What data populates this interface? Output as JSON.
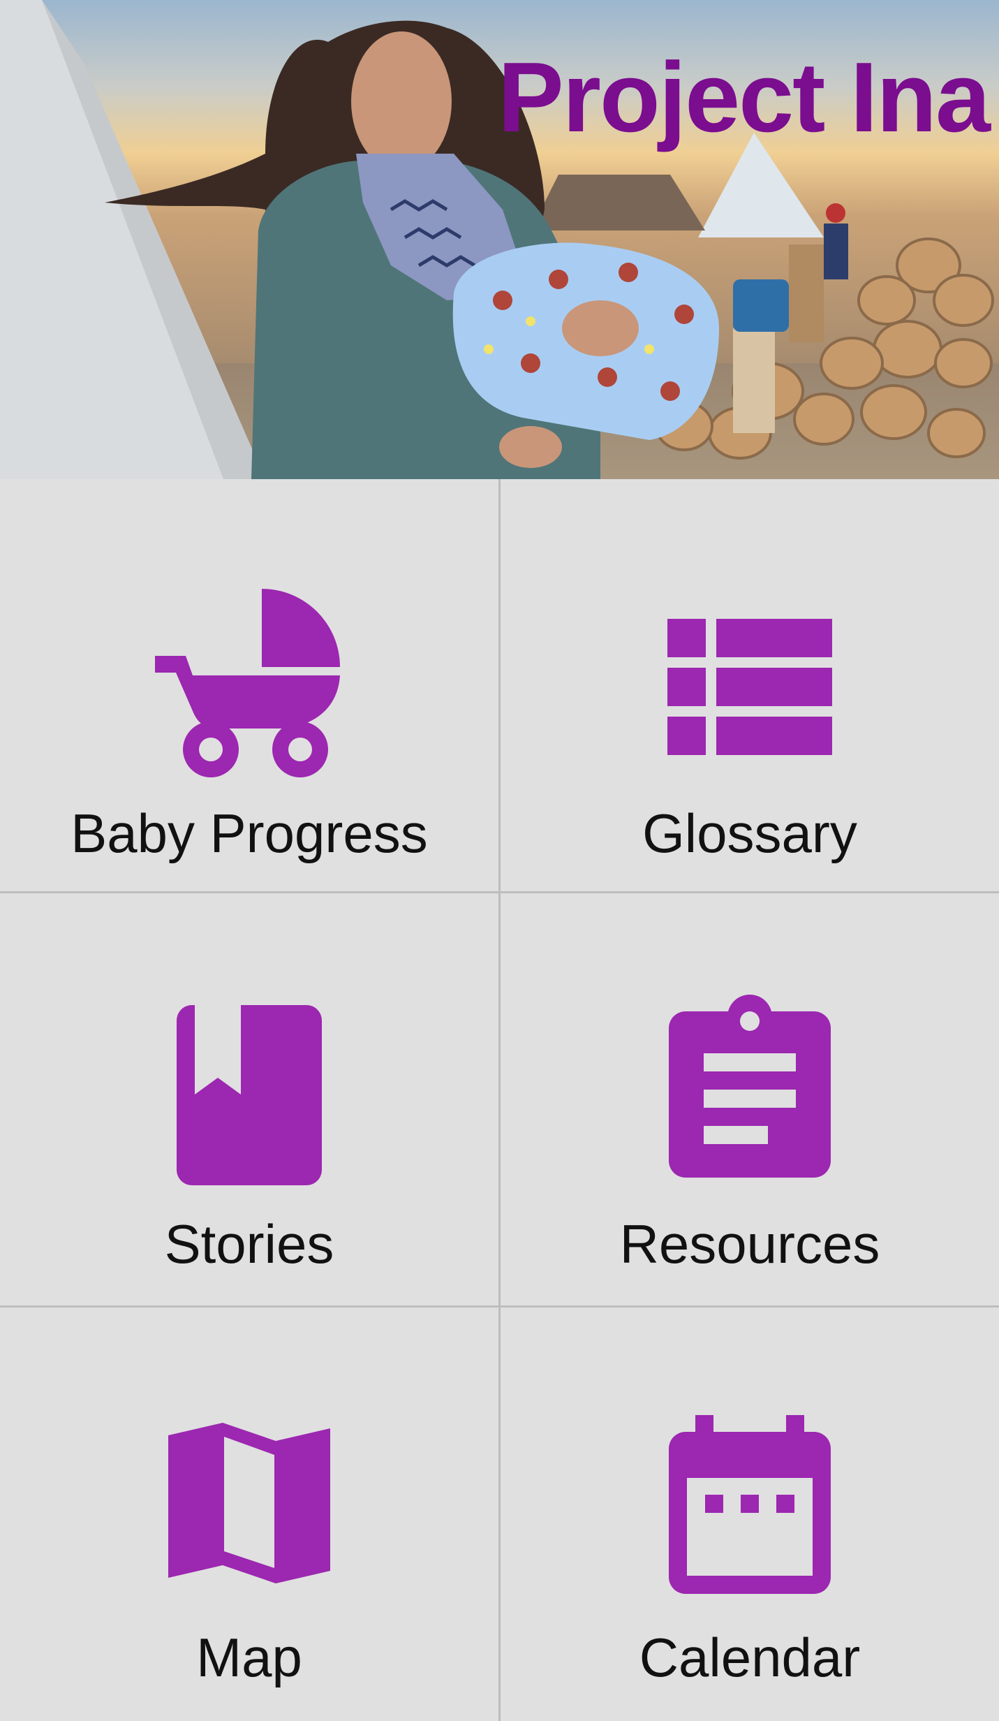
{
  "app": {
    "title": "Project Ina",
    "title_color": "#7b0d8f",
    "accent_color": "#9c27b0",
    "background_color": "#e0e0e0",
    "divider_color": "#bdbdbd"
  },
  "hero": {
    "image": "photo of a woman holding a baby wrapped in a blue blanket outside tipis"
  },
  "menu": {
    "tiles": [
      {
        "label": "Baby Progress",
        "icon": "stroller-icon"
      },
      {
        "label": "Glossary",
        "icon": "list-icon"
      },
      {
        "label": "Stories",
        "icon": "book-icon"
      },
      {
        "label": "Resources",
        "icon": "clipboard-icon"
      },
      {
        "label": "Map",
        "icon": "map-icon"
      },
      {
        "label": "Calendar",
        "icon": "calendar-icon"
      }
    ]
  }
}
